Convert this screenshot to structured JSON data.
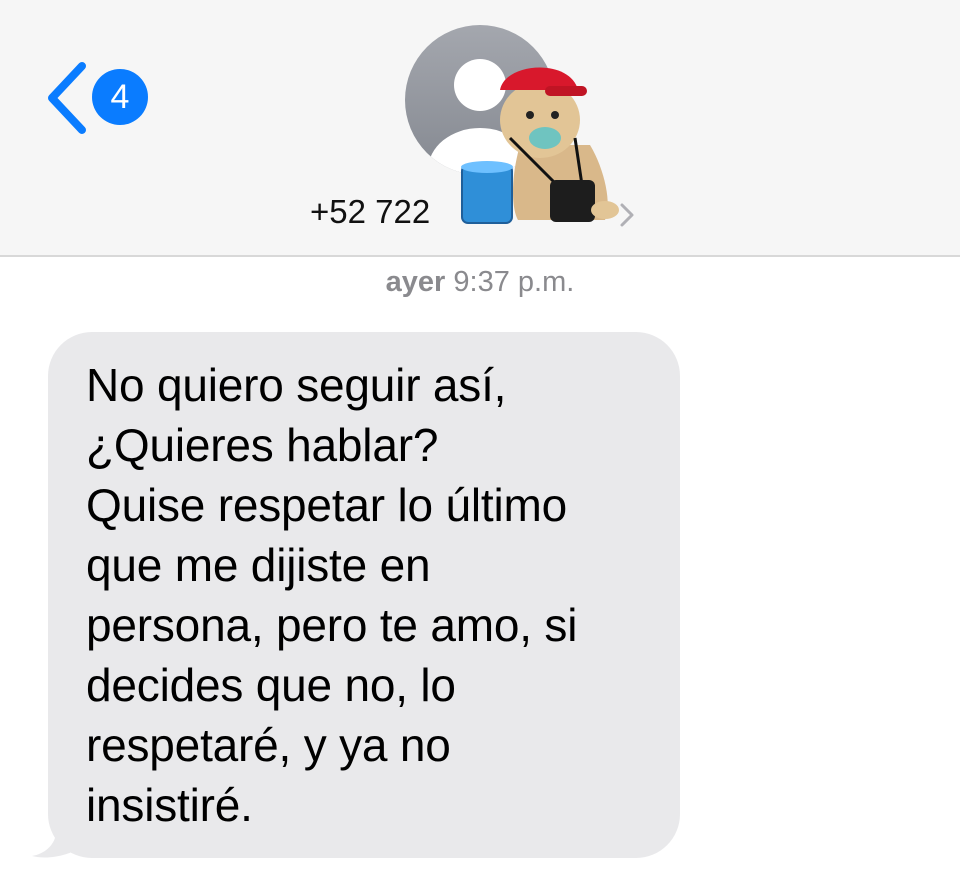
{
  "header": {
    "unread_count": "4",
    "contact_number": "+52 722",
    "back_icon": "chevron-left-icon",
    "detail_icon": "chevron-right-icon",
    "avatar_icon": "person-silhouette-icon",
    "accent_color": "#0a7cff"
  },
  "conversation": {
    "timestamp_day": "ayer",
    "timestamp_time": "9:37 p.m.",
    "messages": [
      {
        "direction": "incoming",
        "text": "No quiero seguir así,\n¿Quieres hablar?\nQuise respetar lo último\nque me dijiste en\npersona, pero te amo, si\ndecides que no, lo\nrespetaré, y ya no\ninsistiré.",
        "bubble_color": "#e9e9eb"
      }
    ]
  }
}
